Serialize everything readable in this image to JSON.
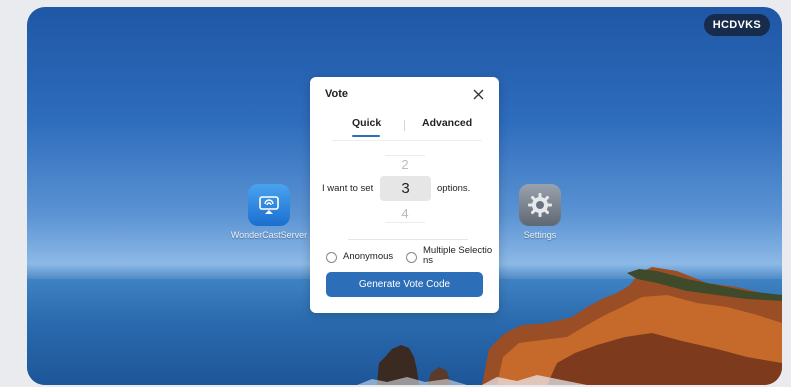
{
  "device": {
    "code": "HCDVKS"
  },
  "desktop": {
    "apps": [
      {
        "label": "WonderCastServer",
        "icon": "cast-icon"
      },
      {
        "label": "Settings",
        "icon": "gear-icon"
      }
    ]
  },
  "dialog": {
    "title": "Vote",
    "close_icon": "close-icon",
    "tabs": [
      {
        "label": "Quick",
        "active": true
      },
      {
        "label": "Advanced",
        "active": false
      }
    ],
    "picker": {
      "prefix": "I want to set",
      "suffix": "options.",
      "prev": "2",
      "selected": "3",
      "next": "4"
    },
    "options": {
      "anonymous": "Anonymous",
      "multiple_line1": "Multiple Selectio",
      "multiple_line2": "ns"
    },
    "generate_button": "Generate Vote Code"
  },
  "colors": {
    "accent": "#2c6fb8",
    "badge": "#172c4c"
  }
}
